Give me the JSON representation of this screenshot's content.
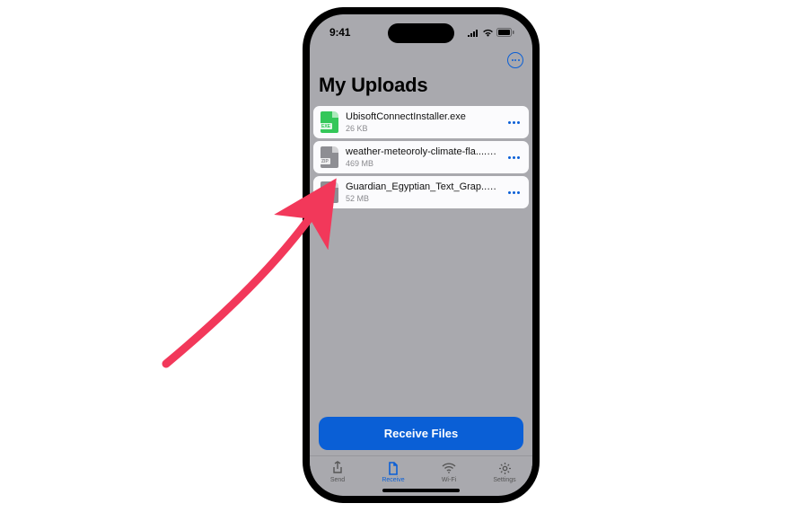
{
  "status": {
    "time": "9:41"
  },
  "header": {
    "title": "My Uploads"
  },
  "files": [
    {
      "name": "UbisoftConnectInstaller.exe",
      "size": "26 KB",
      "type": "exe",
      "type_label": "EXE"
    },
    {
      "name": "weather-meteoroly-climate-fla....zip",
      "size": "469 MB",
      "type": "zip",
      "type_label": "ZIP"
    },
    {
      "name": "Guardian_Egyptian_Text_Grap....zip",
      "size": "52 MB",
      "type": "zip",
      "type_label": "ZIP"
    }
  ],
  "actions": {
    "receive": "Receive Files"
  },
  "tabs": [
    {
      "label": "Send",
      "icon": "share-icon",
      "active": false
    },
    {
      "label": "Receive",
      "icon": "document-icon",
      "active": true
    },
    {
      "label": "Wi-Fi",
      "icon": "wifi-icon",
      "active": false
    },
    {
      "label": "Settings",
      "icon": "gear-icon",
      "active": false
    }
  ],
  "colors": {
    "accent": "#0a5fd6",
    "annotation": "#f2385a"
  }
}
